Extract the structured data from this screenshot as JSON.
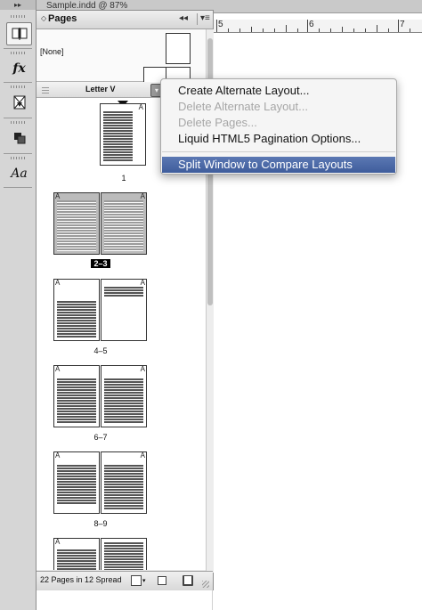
{
  "document": {
    "tab_title": "Sample.indd @ 87%",
    "ruler_numbers": [
      "5",
      "6",
      "7"
    ]
  },
  "tools": [
    {
      "icon": "pages-icon",
      "active": true
    },
    {
      "icon": "effects-fx-icon",
      "glyph": "fx"
    },
    {
      "icon": "links-icon"
    },
    {
      "icon": "layers-icon"
    },
    {
      "icon": "character-styles-icon",
      "glyph": "Aa"
    }
  ],
  "panel": {
    "title": "Pages",
    "none_master": "[None]",
    "layout_name": "Letter V",
    "footer_text": "22 Pages in 12 Spread"
  },
  "spreads": [
    {
      "label": "1",
      "pages": [
        "A"
      ],
      "single": true
    },
    {
      "label": "2–3",
      "pages": [
        "A",
        "A"
      ],
      "selected": true
    },
    {
      "label": "4–5",
      "pages": [
        "A",
        "A"
      ]
    },
    {
      "label": "6–7",
      "pages": [
        "A",
        "A"
      ]
    },
    {
      "label": "8–9",
      "pages": [
        "A",
        "A"
      ]
    },
    {
      "label": "",
      "pages": [
        "A"
      ],
      "partial": true
    }
  ],
  "context_menu": {
    "items": [
      {
        "label": "Create Alternate Layout...",
        "enabled": true
      },
      {
        "label": "Delete Alternate Layout...",
        "enabled": false
      },
      {
        "label": "Delete Pages...",
        "enabled": false
      },
      {
        "label": "Liquid HTML5 Pagination Options...",
        "enabled": true
      },
      {
        "label": "Split Window to Compare Layouts",
        "enabled": true,
        "highlighted": true
      }
    ]
  },
  "colors": {
    "menu_highlight": "#4f6aa3",
    "panel_bg": "#e8e8e8"
  }
}
